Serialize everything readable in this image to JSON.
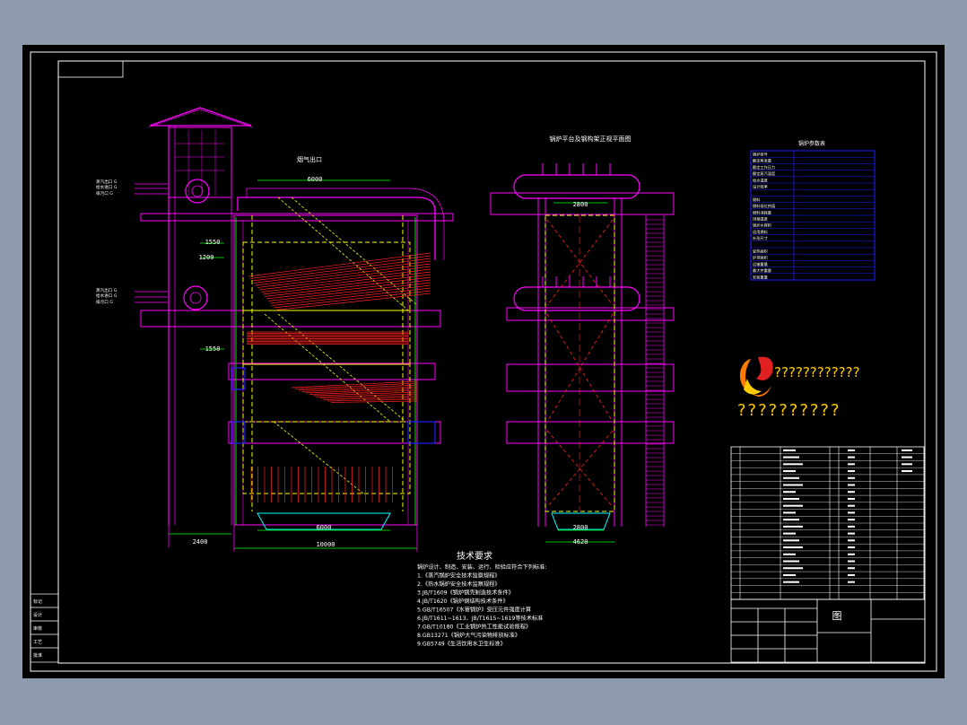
{
  "window": {
    "background": "#8e9aae",
    "sheet": "#000000"
  },
  "colors": {
    "magenta": "#ff00ff",
    "yellow": "#ffff00",
    "green": "#00ff00",
    "red": "#ff2020",
    "white": "#ffffff",
    "cyan": "#00ffff",
    "blue": "#2020ff",
    "orange": "#ff7a00"
  },
  "title_frame": {
    "corner_tag": ""
  },
  "views": {
    "side_view_label": "烟气出口",
    "front_view_title": "锅炉平台及钢构架正视平面图"
  },
  "side_left_labels": [
    "蒸汽出口 G",
    "给水进口 G",
    "排污口 G",
    "蒸汽出口 G",
    "给水进口 G",
    "排污口 G"
  ],
  "dimensions": {
    "side_top_width": "6000",
    "side_level1": "1550",
    "side_level2": "1200",
    "side_level3": "1550",
    "side_bottom_inner": "6000",
    "side_bottom_outer": "10000",
    "side_left_base": "2400",
    "front_top": "2800",
    "front_bottom_inner": "2800",
    "front_bottom_outer": "4620"
  },
  "tech_notes": {
    "title": "技术要求",
    "lines": [
      "锅炉设计、制造、安装、运行、检验应符合下列标准:",
      "1.《蒸汽锅炉安全技术监察规程》",
      "2.《热水锅炉安全技术监察规程》",
      "3.JB/T1609《锅炉锅壳制造技术条件》",
      "4.JB/T1620《锅炉钢结构技术条件》",
      "5.GB/T16507《水管锅炉》受压元件强度计算",
      "6.JB/T1611~1613、JB/T1615~1619等技术标准",
      "7.GB/T10180《工业锅炉热工性能试验规程》",
      "8.GB13271《锅炉大气污染物排放标准》",
      "9.GB5749《生活饮用水卫生标准》"
    ]
  },
  "param_table": {
    "title": "锅炉参数表",
    "rows": [
      [
        "锅炉型号",
        "",
        ""
      ],
      [
        "额定蒸发量",
        "",
        ""
      ],
      [
        "额定工作压力",
        "",
        ""
      ],
      [
        "额定蒸汽温度",
        "",
        ""
      ],
      [
        "给水温度",
        "",
        ""
      ],
      [
        "设计效率",
        "",
        ""
      ],
      [
        "",
        "",
        ""
      ],
      [
        "燃料",
        "",
        ""
      ],
      [
        "燃料低位热值",
        "",
        ""
      ],
      [
        "燃料消耗量",
        "",
        ""
      ],
      [
        "排烟温度",
        "",
        ""
      ],
      [
        "锅炉水容积",
        "",
        ""
      ],
      [
        "适用燃料",
        "",
        ""
      ],
      [
        "外形尺寸",
        "",
        ""
      ],
      [
        "",
        "",
        ""
      ],
      [
        "受热面积",
        "",
        ""
      ],
      [
        "炉排面积",
        "",
        ""
      ],
      [
        "运输重量",
        "",
        ""
      ],
      [
        "最大件重量",
        "",
        ""
      ],
      [
        "安装重量",
        "",
        ""
      ]
    ]
  },
  "watermark": {
    "logo_text": "????????????",
    "sub_text": "??????????"
  },
  "parts_list": {
    "rows": 22
  },
  "title_block": {
    "drawing_title": "图"
  },
  "revision_block": {
    "labels": [
      "标记",
      "设计",
      "审核",
      "工艺",
      "批准"
    ]
  }
}
